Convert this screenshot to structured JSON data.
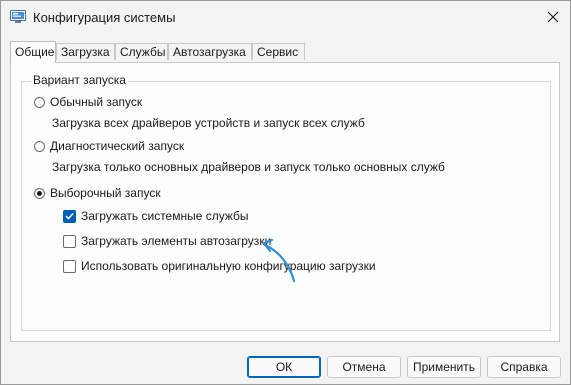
{
  "window": {
    "title": "Конфигурация системы"
  },
  "tabs": [
    "Общие",
    "Загрузка",
    "Службы",
    "Автозагрузка",
    "Сервис"
  ],
  "group": {
    "legend": "Вариант запуска"
  },
  "options": {
    "normal": {
      "label": "Обычный запуск",
      "desc": "Загрузка всех драйверов устройств и запуск всех служб",
      "selected": false
    },
    "diagnostic": {
      "label": "Диагностический запуск",
      "desc": "Загрузка только основных драйверов и запуск только основных служб",
      "selected": false
    },
    "selective": {
      "label": "Выборочный запуск",
      "selected": true
    }
  },
  "checkboxes": {
    "system_services": {
      "label": "Загружать системные службы",
      "checked": true
    },
    "startup_items": {
      "label": "Загружать элементы автозагрузки",
      "checked": false
    },
    "original_config": {
      "label": "Использовать оригинальную конфигурацию загрузки",
      "checked": false
    }
  },
  "buttons": {
    "ok": "ОК",
    "cancel": "Отмена",
    "apply": "Применить",
    "help": "Справка"
  },
  "colors": {
    "accent": "#005fb8",
    "annotation_arrow": "#2f8fd8"
  }
}
